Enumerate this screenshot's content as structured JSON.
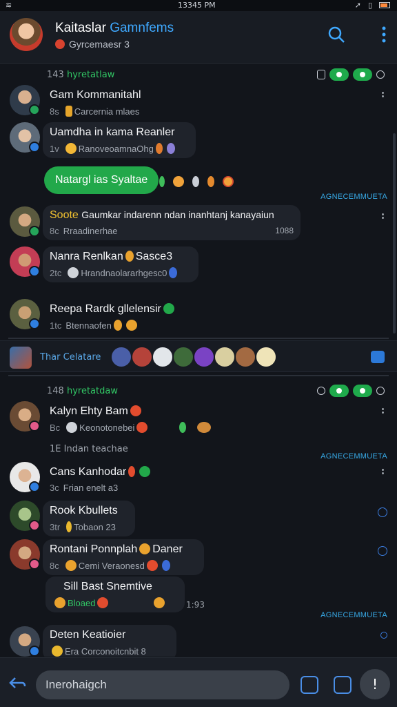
{
  "status_bar": {
    "time": "13345 PM"
  },
  "header": {
    "title_part1": "Kaitaslar",
    "title_part2": "Gamnfems",
    "subtitle": "Gyrcemaesr 3"
  },
  "sections": [
    {
      "count_prefix": "143",
      "count_label": "hyretatlaw"
    },
    {
      "count_prefix": "148",
      "count_label": "hyretatdaw"
    }
  ],
  "messages": [
    {
      "name": "Gam Kommanitahl",
      "meta_num": "8s",
      "meta": "Carcernia mlaes"
    },
    {
      "name": "Uamdha in kama Reanler",
      "meta_num": "1v",
      "meta": "RanoveoamnaOhg"
    },
    {
      "green_bubble": "Natargl ias Syaltae"
    },
    {
      "name": "Soote",
      "name_rest": "Gaumkar indarenn ndan inanhtanj kanayaiun",
      "meta_num": "8c",
      "meta": "Rraadinerhae",
      "time": "1088"
    },
    {
      "name": "Nanra Renlkan",
      "name_rest": "Sasce3",
      "meta_num": "2tc",
      "meta": "Hrandnaolararhgesc0"
    },
    {
      "name": "Reepa Rardk gllelensir",
      "meta_num": "1tc",
      "meta": "Btennaofen"
    },
    {
      "name": "Kalyn Ehty Bam",
      "meta_num": "Bc",
      "meta": "Keonotonebei"
    },
    {
      "line": "1E Indan teachae"
    },
    {
      "name": "Cans Kanhodar",
      "meta_num": "3c",
      "meta": "Frian enelt a3"
    },
    {
      "name": "Rook Kbullets",
      "meta_num": "3tr",
      "meta": "Tobaon 23"
    },
    {
      "name": "Rontani Ponnplah",
      "name_rest": "Daner",
      "meta_num": "8c",
      "meta": "Cemi Veraonesd"
    },
    {
      "name": "Sill Bast Snemtive",
      "meta": "Bloaed"
    },
    {
      "name": "Deten Keatioier",
      "meta": "Era Corconoitcnbit 8"
    }
  ],
  "labels": {
    "announce": "AGNECEMMUETA",
    "strip": "Thar Celatare",
    "small_time": "1:93"
  },
  "composer": {
    "placeholder": "Inerohaigch",
    "mic": "!"
  },
  "colors": {
    "accent": "#3fa9ff",
    "green": "#22a84a",
    "bg": "#12151b"
  }
}
